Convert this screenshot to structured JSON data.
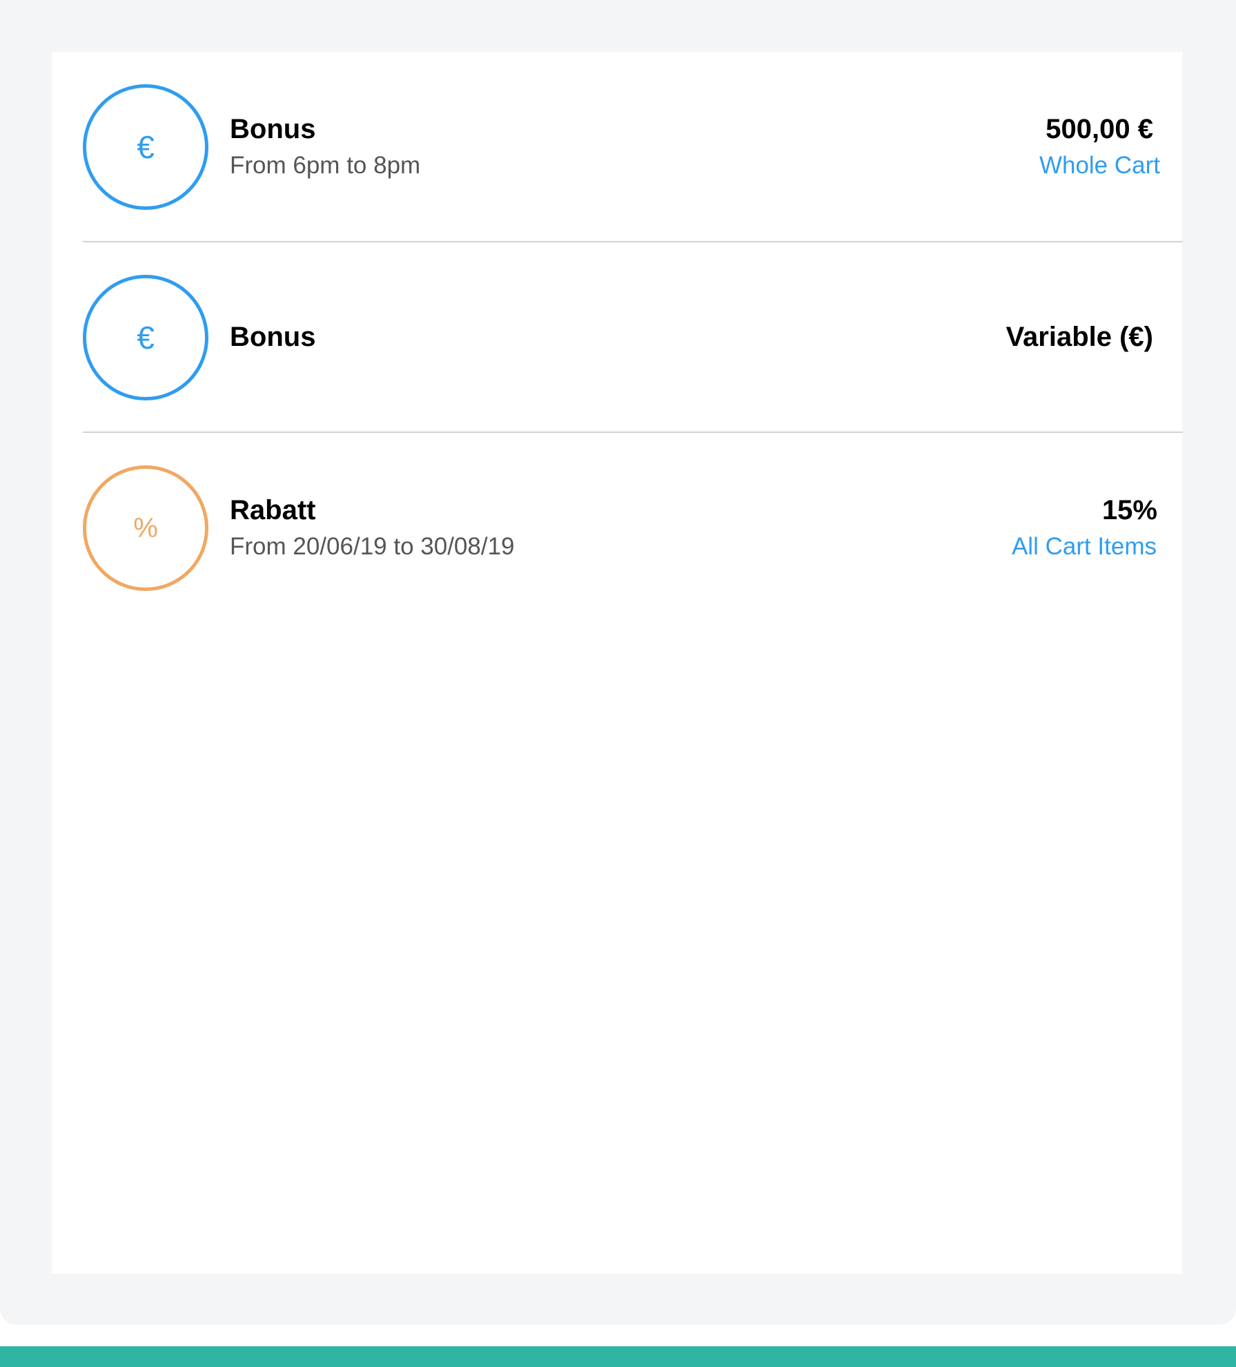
{
  "colors": {
    "accent_blue": "#2f9df0",
    "accent_orange": "#f0a862",
    "bottom_bar": "#2fb5a3",
    "background": "#f4f5f7"
  },
  "offers": [
    {
      "icon": "euro-icon",
      "symbol": "€",
      "title": "Bonus",
      "subtitle": "From 6pm to 8pm",
      "value": "500,00 €",
      "scope": "Whole Cart"
    },
    {
      "icon": "euro-icon",
      "symbol": "€",
      "title": "Bonus",
      "subtitle": "",
      "value": "Variable (€)",
      "scope": ""
    },
    {
      "icon": "percent-icon",
      "symbol": "%",
      "title": "Rabatt",
      "subtitle": "From 20/06/19 to 30/08/19",
      "value": "15%",
      "scope": "All Cart Items"
    }
  ]
}
